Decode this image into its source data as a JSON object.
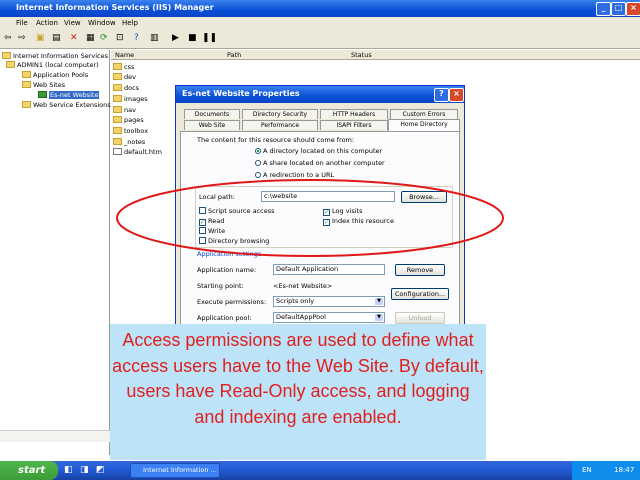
{
  "window": {
    "title": "Internet Information Services (IIS) Manager"
  },
  "menu": [
    "File",
    "Action",
    "View",
    "Window",
    "Help"
  ],
  "tree": {
    "root": "Internet Information Services",
    "computer": "ADMIN1 (local computer)",
    "app_pools": "Application Pools",
    "web_sites": "Web Sites",
    "selected_site": "Es-net Website",
    "extensions": "Web Service Extensions"
  },
  "list": {
    "columns": [
      "Name",
      "Path",
      "Status"
    ],
    "files": [
      "css",
      "dev",
      "docs",
      "images",
      "nav",
      "pages",
      "toolbox",
      "_notes",
      "default.htm"
    ]
  },
  "dialog": {
    "title": "Es-net Website Properties",
    "tabs_row1": [
      "Documents",
      "Directory Security",
      "HTTP Headers",
      "Custom Errors"
    ],
    "tabs_row2": [
      "Web Site",
      "Performance",
      "ISAPI Filters",
      "Home Directory"
    ],
    "content_from": "The content for this resource should come from:",
    "radios": [
      "A directory located on this computer",
      "A share located on another computer",
      "A redirection to a URL"
    ],
    "local_path_label": "Local path:",
    "local_path_value": "c:\\website",
    "browse": "Browse...",
    "checks_left": [
      {
        "label": "Script source access",
        "checked": false
      },
      {
        "label": "Read",
        "checked": true
      },
      {
        "label": "Write",
        "checked": false
      },
      {
        "label": "Directory browsing",
        "checked": false
      }
    ],
    "checks_right": [
      {
        "label": "Log visits",
        "checked": true
      },
      {
        "label": "Index this resource",
        "checked": true
      }
    ],
    "app_settings": "Application settings",
    "app_name_label": "Application name:",
    "app_name_value": "Default Application",
    "remove": "Remove",
    "start_point_label": "Starting point:",
    "start_point_value": "<Es-net Website>",
    "configuration": "Configuration...",
    "exec_label": "Execute permissions:",
    "exec_value": "Scripts only",
    "pool_label": "Application pool:",
    "pool_value": "DefaultAppPool",
    "unload": "Unload"
  },
  "caption": "Access permissions are used to define what access users have to the Web Site. By default, users have Read-Only access, and logging and indexing are enabled.",
  "taskbar": {
    "start": "start",
    "task": "Internet Information ...",
    "lang": "EN",
    "clock": "18:47"
  },
  "colors": {
    "highlight_ellipse": "#e01818",
    "caption_bg": "#bde3f8",
    "caption_text": "#e0201e"
  }
}
